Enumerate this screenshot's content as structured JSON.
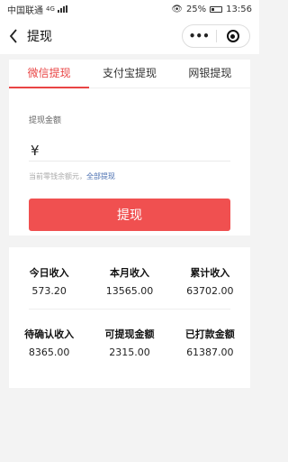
{
  "status": {
    "carrier": "中国联通",
    "network": "4G",
    "battery": "25%",
    "time": "13:56"
  },
  "nav": {
    "back_icon": "chevron-left-icon",
    "title": "提现",
    "more": "•••"
  },
  "tabs": [
    {
      "label": "微信提现",
      "active": true
    },
    {
      "label": "支付宝提现",
      "active": false
    },
    {
      "label": "网银提现",
      "active": false
    }
  ],
  "withdraw": {
    "amount_label": "提现金额",
    "currency": "¥",
    "amount_value": "",
    "hint": "当前零钱余额元，",
    "hint_link": "全部提现",
    "button": "提现"
  },
  "stats": [
    {
      "label": "今日收入",
      "value": "573.20"
    },
    {
      "label": "本月收入",
      "value": "13565.00"
    },
    {
      "label": "累计收入",
      "value": "63702.00"
    },
    {
      "label": "待确认收入",
      "value": "8365.00"
    },
    {
      "label": "可提现金额",
      "value": "2315.00"
    },
    {
      "label": "已打款金额",
      "value": "61387.00"
    }
  ],
  "colors": {
    "accent": "#e94545",
    "button": "#f05050",
    "link": "#4a6fb0"
  }
}
